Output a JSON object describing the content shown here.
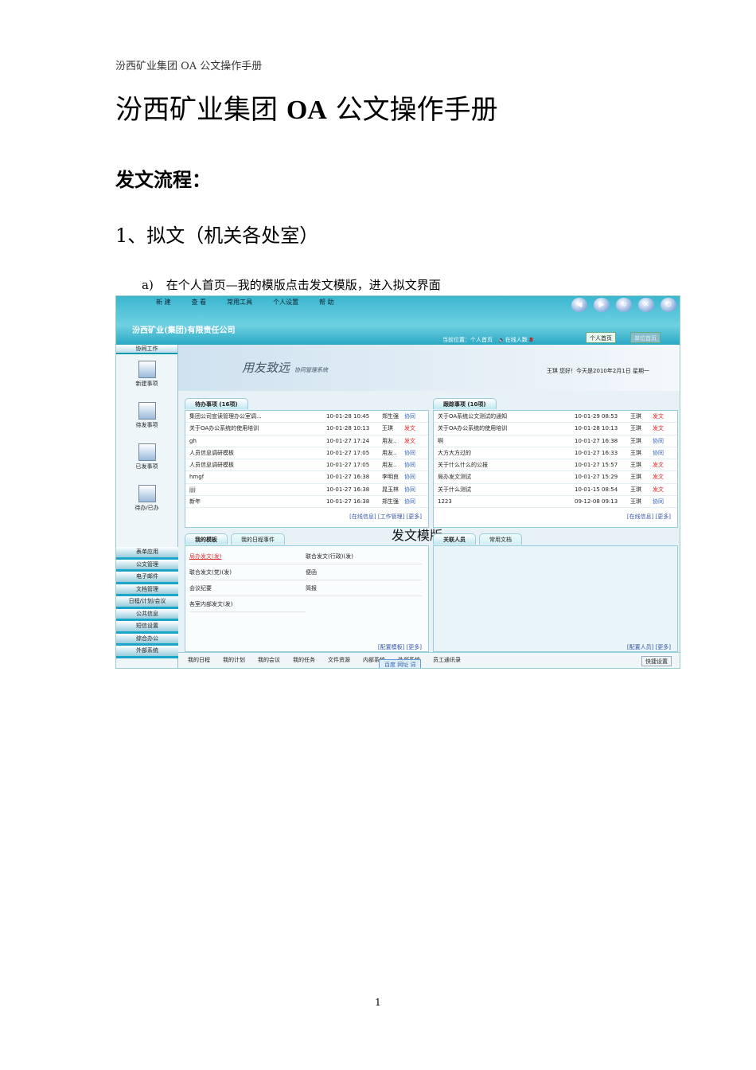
{
  "header": "汾西矿业集团 OA 公文操作手册",
  "title_pre": "汾西矿业集团 ",
  "title_bold": "OA",
  "title_post": " 公文操作手册",
  "section": "发文流程：",
  "subsection": "1、拟文（机关各处室）",
  "step_label": "a)",
  "step_text": "在个人首页—我的模版点击发文模版，进入拟文界面",
  "page_number": "1",
  "app": {
    "menu": [
      "新 建",
      "查 看",
      "常用工具",
      "个人设置",
      "帮 助"
    ],
    "company": "汾西矿业(集团)有限责任公司",
    "location": "当前位置：个人首页",
    "online_label": "在线人数",
    "online_count": "8",
    "btn_home": "个人首页",
    "btn_unit": "单位首页",
    "brand": "用友致远",
    "brand_sub": "协同管理系统",
    "greeting": "王琪 您好！今天是2010年2月1日 星期一",
    "sidebar_header": "协同工作",
    "sidebar_icons": [
      "新建事项",
      "待发事项",
      "已发事项",
      "待办/已办"
    ],
    "sidebar_menu": [
      "表单应用",
      "公文管理",
      "电子邮件",
      "文档管理",
      "日程/计划/会议",
      "公共信息",
      "短信设置",
      "综合办公",
      "外部系统"
    ],
    "pending": {
      "title": "待办事项 (16项)",
      "rows": [
        {
          "t": "集团公司宣读管理办公室调...",
          "d": "10-01-28 10:45",
          "p": "郑生强",
          "k": "协同"
        },
        {
          "t": "关于OA办公系统的使用培训",
          "d": "10-01-28 10:13",
          "p": "王琪",
          "k": "发文"
        },
        {
          "t": "gh",
          "d": "10-01-27 17:24",
          "p": "用友..",
          "k": "发文"
        },
        {
          "t": "人员信息调研模板",
          "d": "10-01-27 17:05",
          "p": "用友..",
          "k": "协同"
        },
        {
          "t": "人员信息调研模板",
          "d": "10-01-27 17:05",
          "p": "用友..",
          "k": "协同"
        },
        {
          "t": "hmgf",
          "d": "10-01-27 16:38",
          "p": "李明良",
          "k": "协同"
        },
        {
          "t": "jjjj",
          "d": "10-01-27 16:38",
          "p": "晁玉林",
          "k": "协同"
        },
        {
          "t": "新年",
          "d": "10-01-27 16:38",
          "p": "郑生强",
          "k": "协同"
        }
      ],
      "links": "[在线信息] [工作管理] [更多]"
    },
    "tracking": {
      "title": "跟踪事项 (10项)",
      "rows": [
        {
          "t": "关于OA系统公文测试的通知",
          "d": "10-01-29 08:53",
          "p": "王琪",
          "k": "发文"
        },
        {
          "t": "关于OA办公系统的使用培训",
          "d": "10-01-28 10:13",
          "p": "王琪",
          "k": "发文"
        },
        {
          "t": "啊",
          "d": "10-01-27 16:38",
          "p": "王琪",
          "k": "协同"
        },
        {
          "t": "大方大方过的",
          "d": "10-01-27 16:33",
          "p": "王琪",
          "k": "协同"
        },
        {
          "t": "关于什么什么的公报",
          "d": "10-01-27 15:57",
          "p": "王琪",
          "k": "发文"
        },
        {
          "t": "局办发文测试",
          "d": "10-01-27 15:29",
          "p": "王琪",
          "k": "发文"
        },
        {
          "t": "关于什么测试",
          "d": "10-01-15 08:54",
          "p": "王琪",
          "k": "发文"
        },
        {
          "t": "1223",
          "d": "09-12-08 09:13",
          "p": "王琪",
          "k": "协同"
        }
      ],
      "links": "[在线信息] [更多]"
    },
    "overlay_label": "发文模版",
    "templates": {
      "tab1": "我的模板",
      "tab2": "我的日程事件",
      "items": [
        "局办发文(发)",
        "联合发文(行政)(发)",
        "联合发文(党)(发)",
        "便函",
        "会议纪要",
        "简报",
        "各室内部发文(发)"
      ],
      "links": "[配置模板] [更多]"
    },
    "contacts": {
      "tab1": "关联人员",
      "tab2": "常用文档",
      "links": "[配置人员] [更多]"
    },
    "bottom": [
      "我的日程",
      "我的计划",
      "我的会议",
      "我的任务",
      "文件资源",
      "内部系统",
      "外部系统",
      "员工通讯录"
    ],
    "quick": "快捷设置",
    "search": "百度 网址 词"
  }
}
